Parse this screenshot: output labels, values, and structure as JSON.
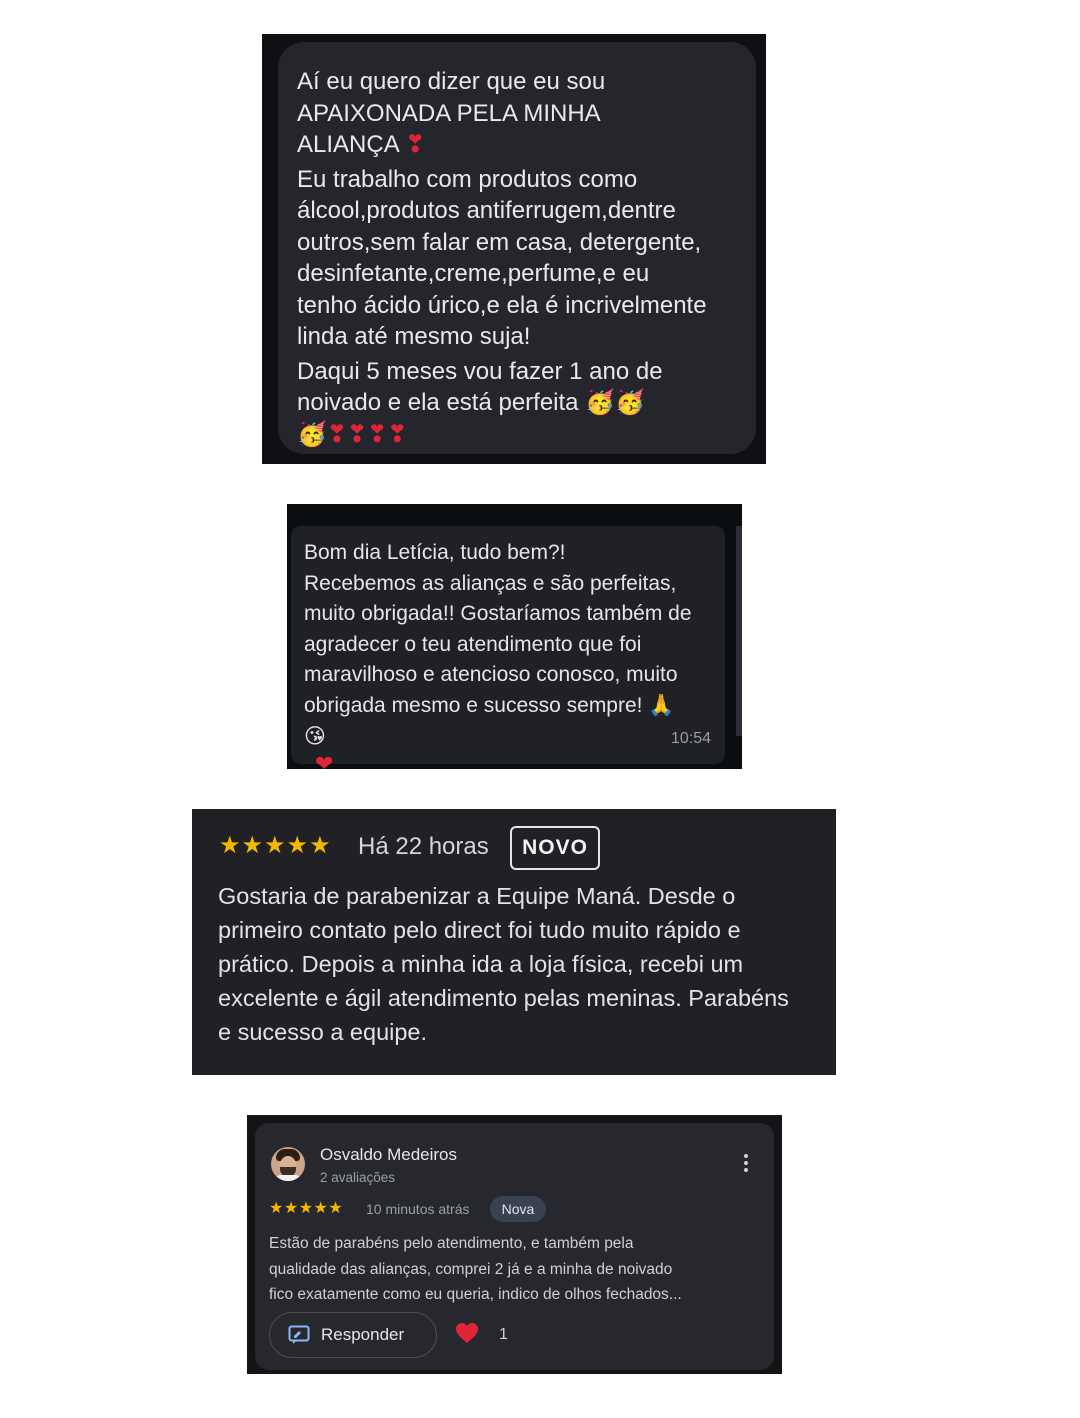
{
  "card1": {
    "lines": [
      "Aí eu quero dizer que eu sou",
      "APAIXONADA PELA MINHA",
      "ALIANÇA",
      "Eu trabalho com produtos como",
      "álcool,produtos antiferrugem,dentre",
      "outros,sem falar em casa, detergente,",
      "desinfetante,creme,perfume,e eu",
      "tenho ácido úrico,e ela é incrivelmente",
      "linda até mesmo suja!",
      "Daqui 5 meses vou fazer 1 ano de",
      "noivado e ela está perfeita"
    ],
    "emoji_heart": "❣",
    "emoji_party": "🥳",
    "emoji_last_line": "🥳❣❣❣❣"
  },
  "card2": {
    "lines": [
      "Bom dia Letícia, tudo bem?!",
      "Recebemos as alianças e são perfeitas,",
      "muito obrigada!! Gostaríamos também de",
      "agradecer o teu atendimento que foi",
      "maravilhoso e atencioso conosco, muito",
      "obrigada mesmo e sucesso sempre! 🙏",
      "😘"
    ],
    "time": "10:54",
    "reaction": "❤"
  },
  "card3": {
    "stars": "★★★★★",
    "when": "Há 22 horas",
    "badge": "NOVO",
    "lines": [
      "Gostaria de parabenizar a Equipe Maná. Desde o",
      "primeiro contato pelo direct foi tudo muito rápido e",
      "prático. Depois a minha ida a loja física, recebi um",
      "excelente e ágil atendimento pelas meninas. Parabéns",
      "e sucesso a equipe."
    ]
  },
  "card4": {
    "name": "Osvaldo Medeiros",
    "reviews": "2 avaliações",
    "stars": "★★★★★",
    "when": "10 minutos atrás",
    "chip": "Nova",
    "lines": [
      "Estão de parabéns pelo atendimento, e também pela",
      "qualidade das alianças, comprei 2 já e a minha de noivado",
      "fico exatamente como eu queria, indico de olhos fechados..."
    ],
    "reply_label": "Responder",
    "likes": "1",
    "colors": {
      "star": "#f5b800",
      "heart": "#e0243a",
      "chip_bg": "#3a4150"
    }
  }
}
